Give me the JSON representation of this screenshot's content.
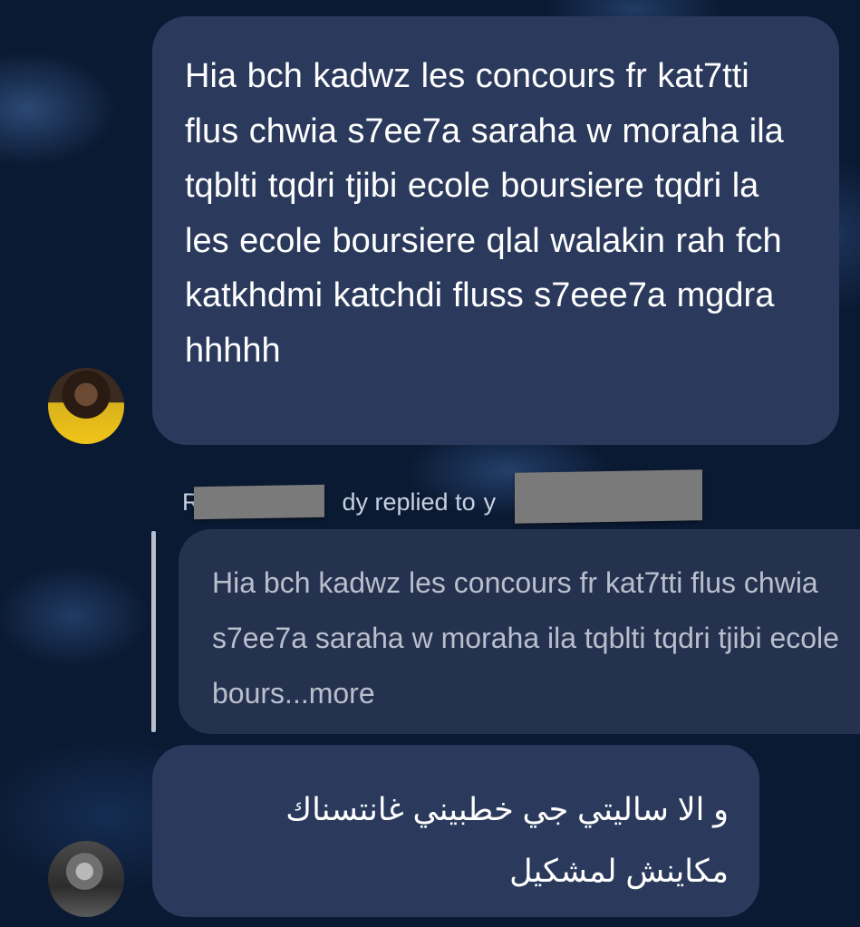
{
  "messages": [
    {
      "text": "Hia bch kadwz les concours fr kat7tti flus chwia s7ee7a saraha w moraha ila tqblti tqdri tjibi ecole boursiere tqdri la les ecole boursiere qlal walakin rah fch katkhdmi katchdi fluss s7eee7a mgdra hhhhh"
    },
    {
      "reply_header": {
        "prefix": "R",
        "middle": "dy replied to",
        "suffix": "y"
      },
      "quoted_text": "Hia bch kadwz les concours fr kat7tti flus chwia s7ee7a saraha w moraha ila tqblti tqdri tjibi ecole bours...more"
    },
    {
      "text": "و الا ساليتي جي خطبيني غانتسناك مكاينش لمشكيل"
    }
  ],
  "colors": {
    "background": "#0b1a33",
    "bubble": "#2b3a5c",
    "quoted_bubble": "#25324f",
    "text": "#ffffff",
    "muted_text": "#b9bfcc",
    "redaction": "#7a7a7a"
  },
  "icons": {
    "avatar_1": "user-avatar-gold",
    "avatar_2": "user-avatar-grey"
  }
}
